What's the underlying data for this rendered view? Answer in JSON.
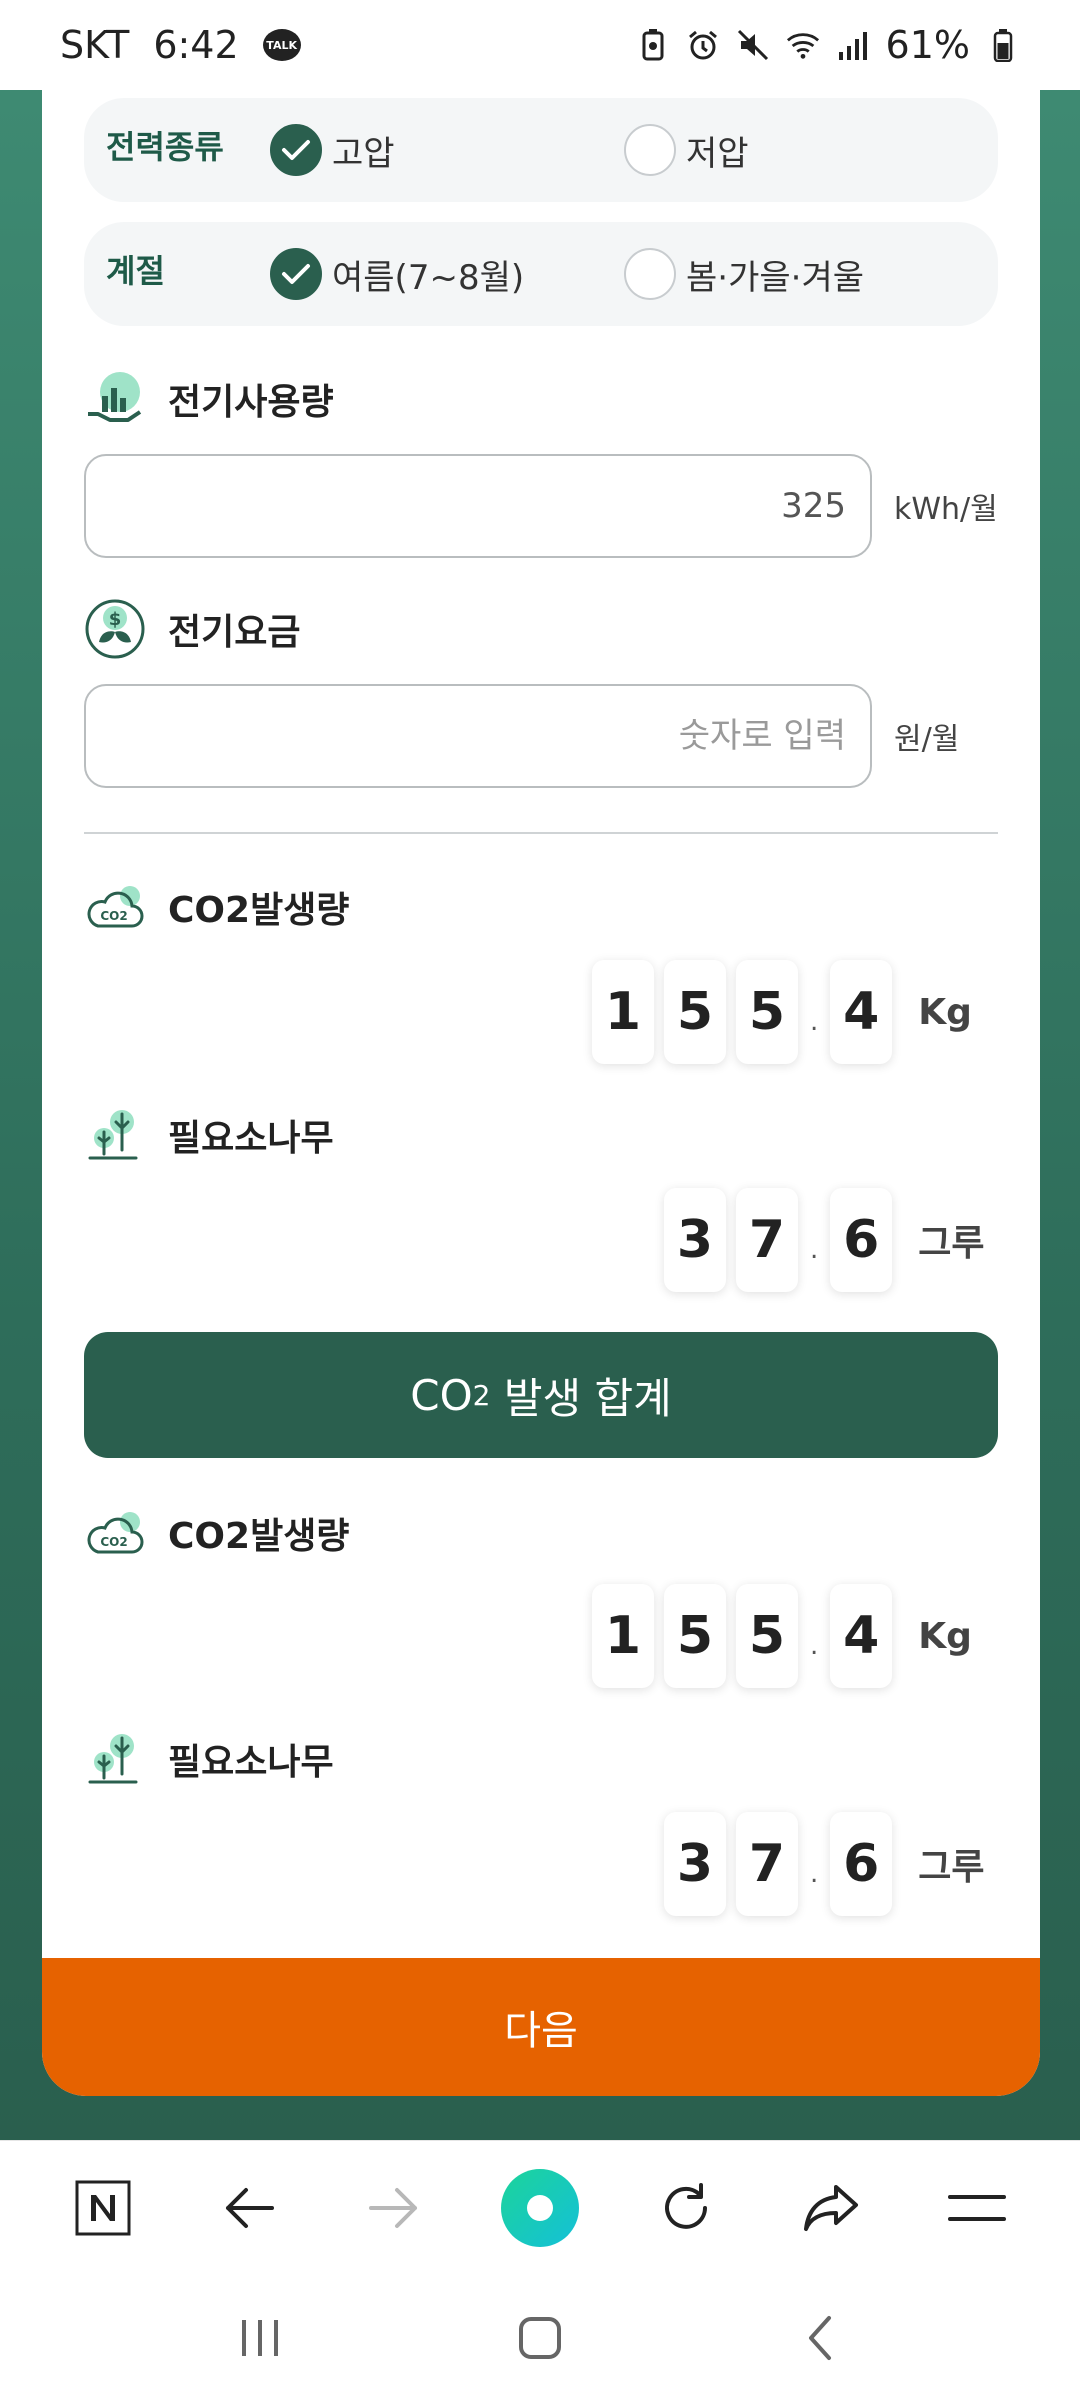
{
  "status_bar": {
    "carrier": "SKT",
    "time": "6:42",
    "chat_badge": "TALK",
    "battery_pct": "61%"
  },
  "power_type": {
    "title": "전력종류",
    "options": [
      {
        "label": "고압",
        "selected": true
      },
      {
        "label": "저압",
        "selected": false
      }
    ]
  },
  "season": {
    "title": "계절",
    "options": [
      {
        "label": "여름(7~8월)",
        "selected": true
      },
      {
        "label": "봄·가을·겨울",
        "selected": false
      }
    ]
  },
  "usage": {
    "label": "전기사용량",
    "value": "325",
    "unit": "kWh/월"
  },
  "fee": {
    "label": "전기요금",
    "placeholder": "숫자로 입력",
    "unit": "원/월"
  },
  "result1": {
    "co2_label": "CO2발생량",
    "co2_digits": [
      "1",
      "5",
      "5",
      "4"
    ],
    "co2_unit": "Kg",
    "tree_label": "필요소나무",
    "tree_digits": [
      "3",
      "7",
      "6"
    ],
    "tree_unit": "그루"
  },
  "sum_button": {
    "prefix": "CO",
    "sub": "2",
    "suffix": " 발생 합계"
  },
  "result2": {
    "co2_label": "CO2발생량",
    "co2_digits": [
      "1",
      "5",
      "5",
      "4"
    ],
    "co2_unit": "Kg",
    "tree_label": "필요소나무",
    "tree_digits": [
      "3",
      "7",
      "6"
    ],
    "tree_unit": "그루"
  },
  "next_button": {
    "label": "다음"
  },
  "toolbar": {
    "naver_logo": "N",
    "icons": [
      "naver-icon",
      "back-arrow-icon",
      "forward-arrow-icon",
      "home-orb-icon",
      "refresh-icon",
      "share-icon",
      "menu-icon"
    ]
  },
  "colors": {
    "primary_green": "#2a5f4e",
    "accent_orange": "#e66200",
    "bg_green": "#3e8a72"
  }
}
